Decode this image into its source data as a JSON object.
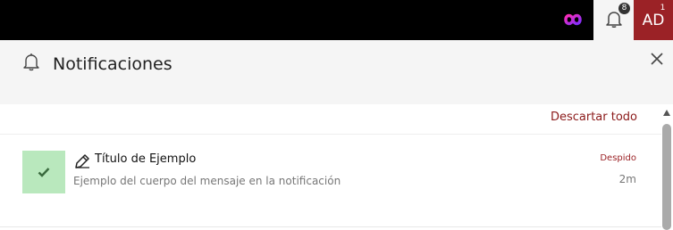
{
  "topbar": {
    "logo_icon": "infinity-logo-icon",
    "bell_icon": "bell-icon",
    "notification_count": "8",
    "avatar_initials": "AD",
    "avatar_badge": "1",
    "accent_color": "#9b2226"
  },
  "panel": {
    "title": "Notificaciones",
    "title_icon": "bell-icon",
    "close_icon": "close-icon",
    "dismiss_all_label": "Descartar todo"
  },
  "notifications": [
    {
      "title": "Título de Ejemplo",
      "body": "Ejemplo del cuerpo del mensaje en la notificación",
      "status": "Despido",
      "time": "2m",
      "status_icon": "check-icon",
      "type_icon": "pen-edit-icon",
      "status_color": "#b9e8bd"
    }
  ]
}
